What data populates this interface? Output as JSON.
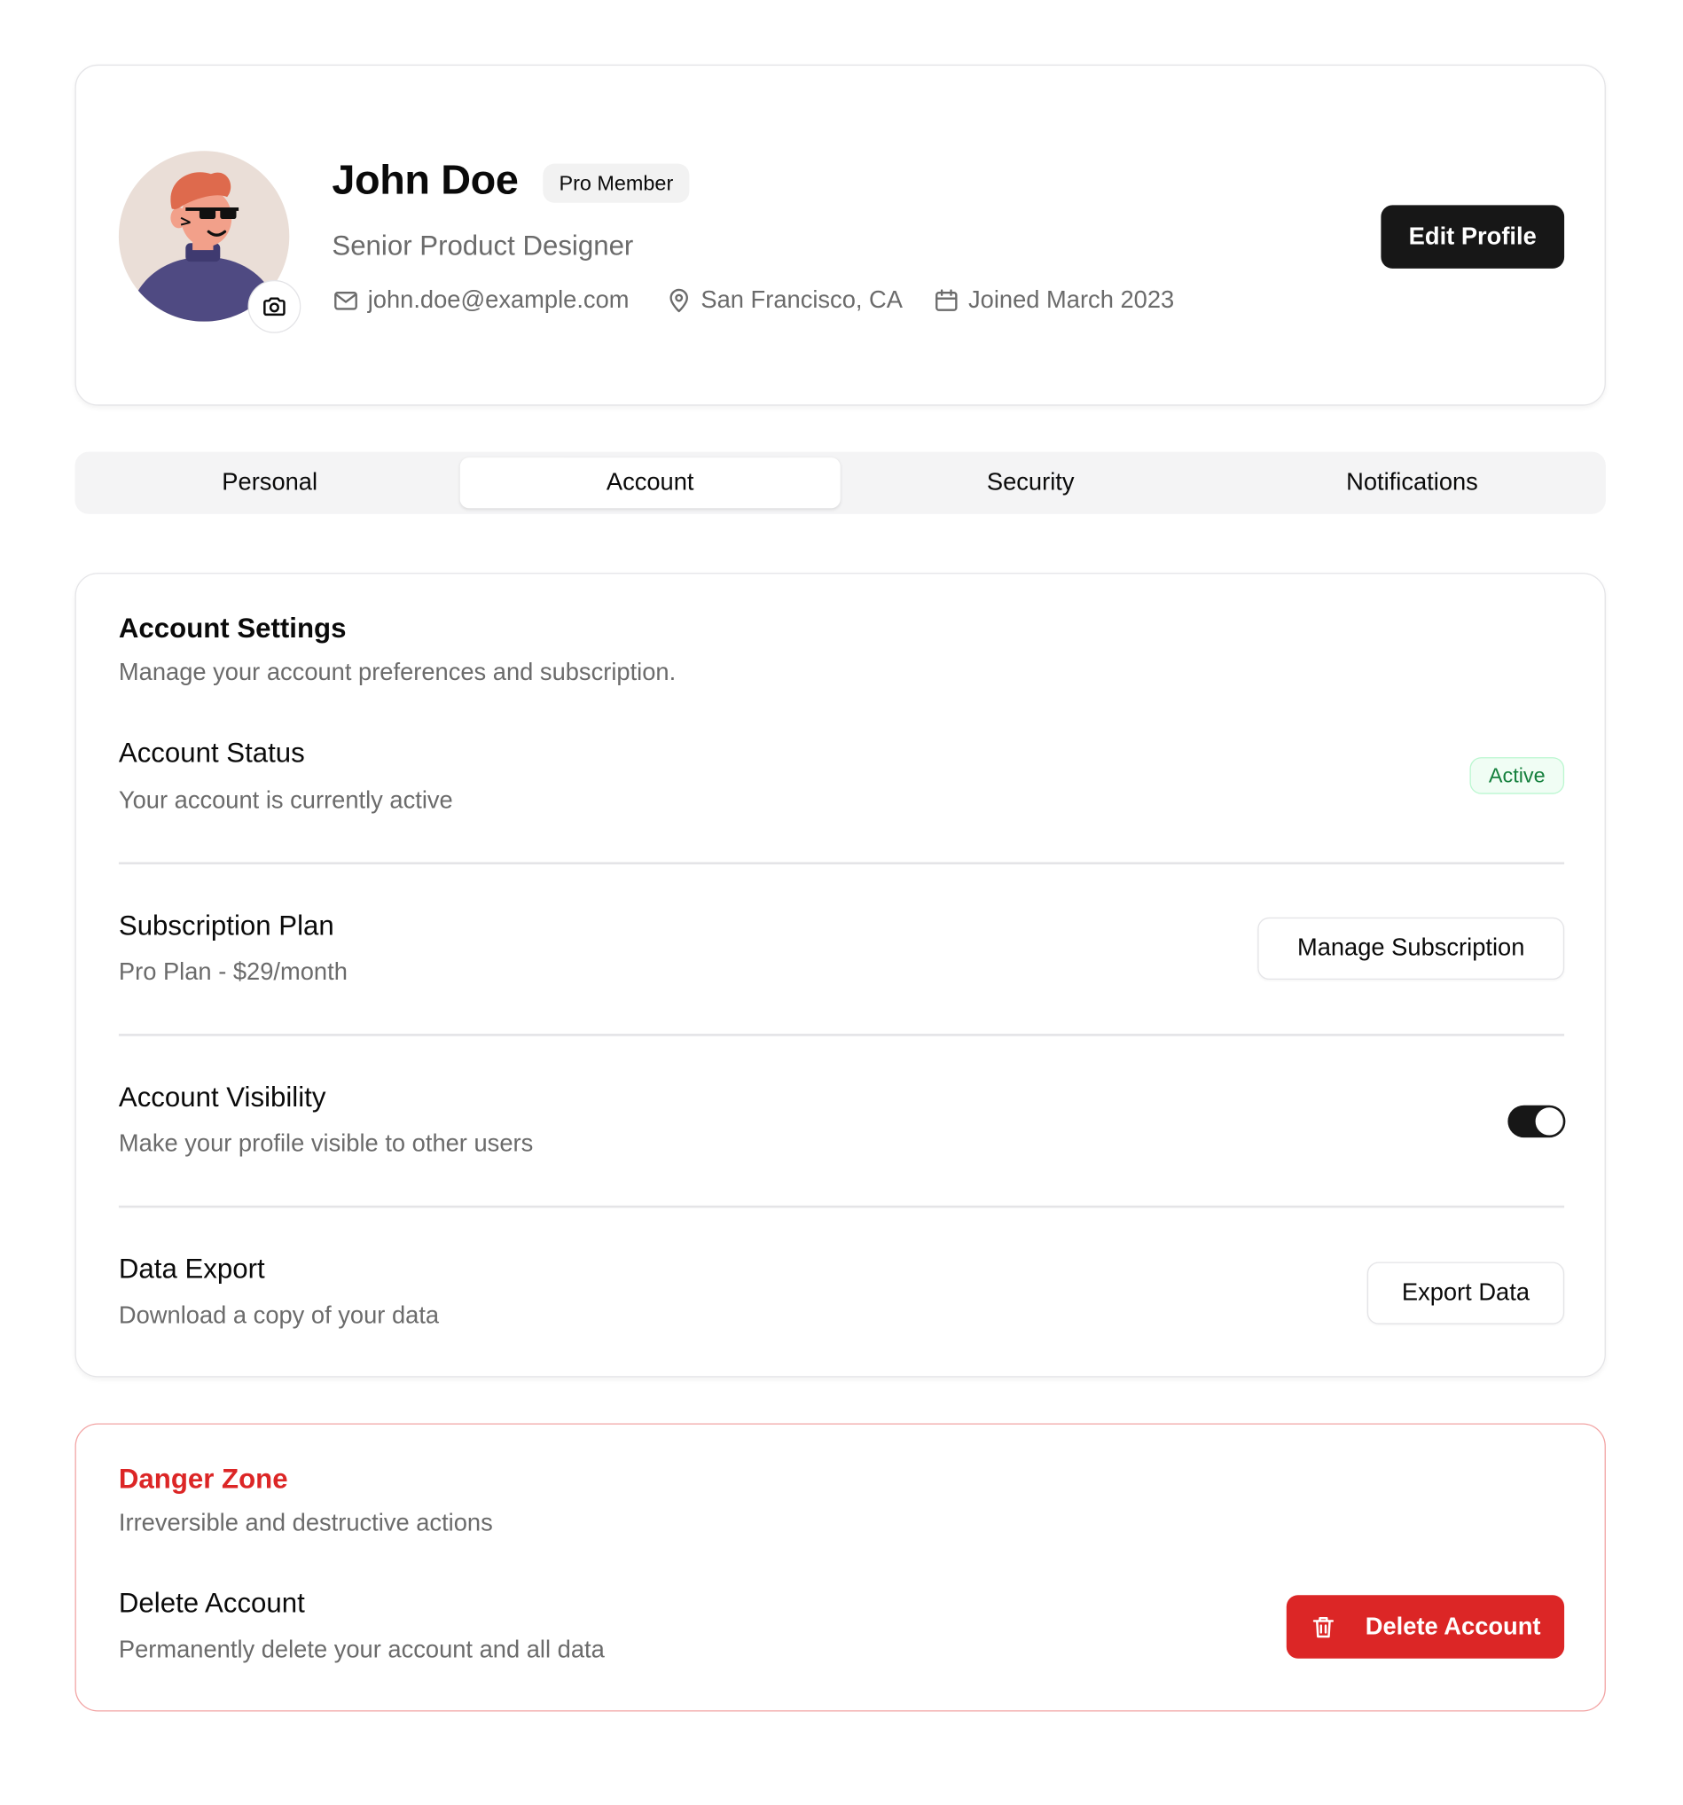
{
  "profile": {
    "name": "John Doe",
    "badge": "Pro Member",
    "title": "Senior Product Designer",
    "email": "john.doe@example.com",
    "location": "San Francisco, CA",
    "joined": "Joined March 2023",
    "edit_label": "Edit Profile",
    "avatar_icon": "camera-icon"
  },
  "tabs": [
    {
      "label": "Personal",
      "active": false
    },
    {
      "label": "Account",
      "active": true
    },
    {
      "label": "Security",
      "active": false
    },
    {
      "label": "Notifications",
      "active": false
    }
  ],
  "account": {
    "heading": "Account Settings",
    "subheading": "Manage your account preferences and subscription.",
    "rows": [
      {
        "title": "Account Status",
        "description": "Your account is currently active",
        "control": "badge",
        "badge": "Active"
      },
      {
        "title": "Subscription Plan",
        "description": "Pro Plan - $29/month",
        "control": "button",
        "button": "Manage Subscription"
      },
      {
        "title": "Account Visibility",
        "description": "Make your profile visible to other users",
        "control": "toggle",
        "toggle_on": true
      },
      {
        "title": "Data Export",
        "description": "Download a copy of your data",
        "control": "button",
        "button": "Export Data"
      }
    ]
  },
  "danger": {
    "heading": "Danger Zone",
    "subheading": "Irreversible and destructive actions",
    "row": {
      "title": "Delete Account",
      "description": "Permanently delete your account and all data",
      "button": "Delete Account",
      "icon": "trash-icon"
    }
  },
  "colors": {
    "primary": "#171717",
    "muted_text": "#6b6b6b",
    "border": "#e4e4e7",
    "success_text": "#15803d",
    "success_bg": "#f0fdf4",
    "danger": "#dc2626",
    "danger_border": "#f2a4a4",
    "tab_bg": "#f4f4f5",
    "avatar_bg": "#eaded7"
  }
}
